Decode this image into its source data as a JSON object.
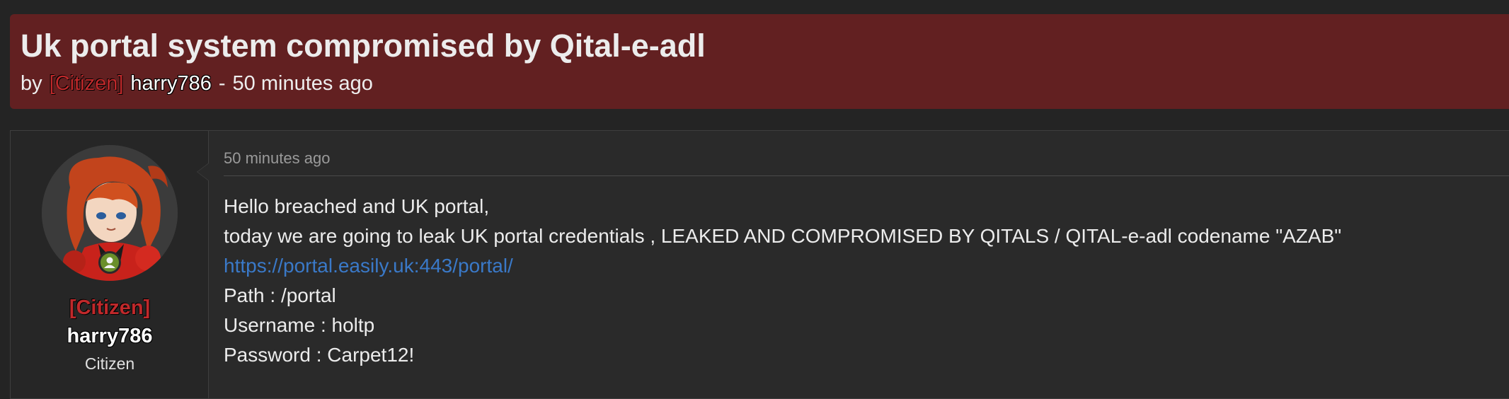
{
  "thread": {
    "title": "Uk portal system compromised by Qital-e-adl",
    "by_label": "by",
    "author_rank": "[Citizen]",
    "author_name": "harry786",
    "separator": "-",
    "posted_ago": "50 minutes ago"
  },
  "post": {
    "date": "50 minutes ago",
    "user": {
      "rank": "[Citizen]",
      "name": "harry786",
      "title": "Citizen",
      "status": "online"
    },
    "lines": [
      "Hello breached and UK portal,",
      "today we are going to leak UK portal credentials , LEAKED AND COMPROMISED BY QITALS / QITAL-e-adl codename \"AZAB\"",
      "https://portal.easily.uk:443/portal/",
      "Path : /portal",
      "Username : holtp",
      "Password : Carpet12!"
    ]
  },
  "colors": {
    "header_bg": "#622021",
    "rank_red": "#c0292b",
    "link_blue": "#3a79c8",
    "online_green": "#6a8f2a"
  },
  "icons": {
    "online_status": "user-online-icon"
  }
}
